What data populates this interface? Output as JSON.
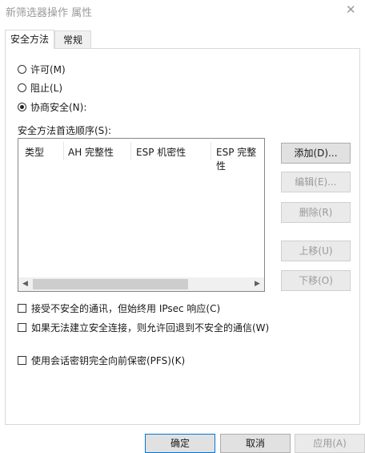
{
  "window": {
    "title": "新筛选器操作 属性",
    "close_glyph": "✕"
  },
  "tabs": [
    {
      "label": "安全方法",
      "active": true
    },
    {
      "label": "常规",
      "active": false
    }
  ],
  "radios": [
    {
      "label": "许可(M)",
      "checked": false
    },
    {
      "label": "阻止(L)",
      "checked": false
    },
    {
      "label": "协商安全(N):",
      "checked": true
    }
  ],
  "methods": {
    "order_label": "安全方法首选顺序(S):",
    "columns": [
      "类型",
      "AH 完整性",
      "ESP 机密性",
      "ESP 完整性"
    ]
  },
  "buttons": {
    "add": "添加(D)...",
    "edit": "编辑(E)...",
    "remove": "删除(R)",
    "move_up": "上移(U)",
    "move_down": "下移(O)"
  },
  "options": [
    {
      "label": "接受不安全的通讯，但始终用 IPsec 响应(C)",
      "checked": false
    },
    {
      "label": "如果无法建立安全连接，则允许回退到不安全的通信(W)",
      "checked": false
    },
    {
      "label": "使用会话密钥完全向前保密(PFS)(K)",
      "checked": false
    }
  ],
  "footer": {
    "ok": "确定",
    "cancel": "取消",
    "apply": "应用(A)"
  },
  "icons": {
    "scroll_left": "◀",
    "scroll_right": "▶"
  },
  "colors": {
    "focus_border": "#0078d7",
    "disabled_text": "#9a9a9a"
  }
}
